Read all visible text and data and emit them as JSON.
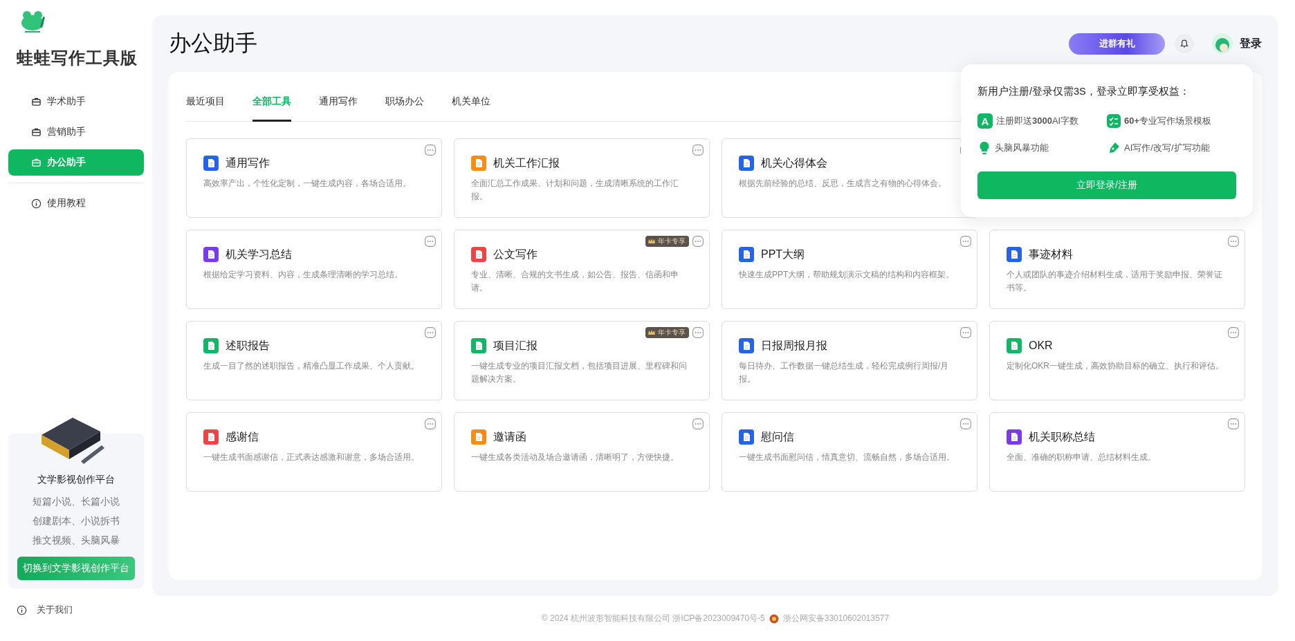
{
  "brand": {
    "title": "蛙蛙写作工具版"
  },
  "nav": [
    {
      "label": "学术助手",
      "selected": false
    },
    {
      "label": "营销助手",
      "selected": false
    },
    {
      "label": "办公助手",
      "selected": true
    }
  ],
  "nav_extra": [
    {
      "label": "使用教程"
    }
  ],
  "promo": {
    "title": "文学影视创作平台",
    "lines": [
      "短篇小说、长篇小说",
      "创建剧本、小说拆书",
      "推文视频、头脑风暴"
    ],
    "button": "切换到文学影视创作平台"
  },
  "about": "关于我们",
  "page_title": "办公助手",
  "header": {
    "group_badge": "进群有礼",
    "login": "登录"
  },
  "tabs": [
    {
      "label": "最近项目",
      "selected": false
    },
    {
      "label": "全部工具",
      "selected": true
    },
    {
      "label": "通用写作",
      "selected": false
    },
    {
      "label": "职场办公",
      "selected": false
    },
    {
      "label": "机关单位",
      "selected": false
    }
  ],
  "card_rows": [
    [
      {
        "title": "通用写作",
        "desc": "高效率产出，个性化定制，一键生成内容，各场合适用。",
        "color": "#2563eb"
      },
      {
        "title": "机关工作汇报",
        "desc": "全面汇总工作成果、计划和问题，生成清晰系统的工作汇报。",
        "color": "#fb8c12"
      },
      {
        "title": "机关心得体会",
        "desc": "根据先前经验的总结、反思，生成言之有物的心得体会。",
        "color": "#2563eb"
      }
    ],
    [
      {
        "title": "机关学习总结",
        "desc": "根据给定学习资料、内容，生成条理清晰的学习总结。",
        "color": "#7c3aed"
      },
      {
        "title": "公文写作",
        "desc": "专业、清晰、合规的文书生成，如公告、报告、信函和申请。",
        "color": "#ef4444",
        "badge": "年卡专享"
      },
      {
        "title": "PPT大纲",
        "desc": "快速生成PPT大纲，帮助规划演示文稿的结构和内容框架。",
        "color": "#2563eb"
      },
      {
        "title": "事迹材料",
        "desc": "个人或团队的事迹介绍材料生成，适用于奖励申报、荣誉证书等。",
        "color": "#2563eb"
      }
    ],
    [
      {
        "title": "述职报告",
        "desc": "生成一目了然的述职报告，精准凸显工作成果、个人贡献。",
        "color": "#10b765"
      },
      {
        "title": "项目汇报",
        "desc": "一键生成专业的项目汇报文档，包括项目进展、里程碑和问题解决方案。",
        "color": "#10b765",
        "badge": "年卡专享"
      },
      {
        "title": "日报周报月报",
        "desc": "每日待办、工作数据一键总结生成，轻松完成例行周报/月报。",
        "color": "#2563eb"
      },
      {
        "title": "OKR",
        "desc": "定制化OKR一键生成，高效协助目标的确立、执行和评估。",
        "color": "#10b765"
      }
    ],
    [
      {
        "title": "感谢信",
        "desc": "一键生成书面感谢信，正式表达感激和谢意，多场合适用。",
        "color": "#ef4444"
      },
      {
        "title": "邀请函",
        "desc": "一键生成各类活动及场合邀请函，清晰明了，方便快捷。",
        "color": "#fb8c12"
      },
      {
        "title": "慰问信",
        "desc": "一键生成书面慰问信，情真意切、流畅自然，多场合适用。",
        "color": "#2563eb"
      },
      {
        "title": "机关职称总结",
        "desc": "全面、准确的职称申请、总结材料生成。",
        "color": "#7c3aed"
      }
    ]
  ],
  "popup": {
    "headline": "新用户注册/登录仅需3S，登录立即享受权益：",
    "perks": [
      {
        "kind": "letter",
        "letter": "A",
        "text": "注册即送**3000**AI字数"
      },
      {
        "kind": "list",
        "text": "**60+**专业写作场景模板"
      },
      {
        "kind": "bulb",
        "text": "头脑风暴功能"
      },
      {
        "kind": "pen",
        "text": "AI写作/改写/扩写功能"
      }
    ],
    "button": "立即登录/注册"
  },
  "footer": {
    "copyright": "© 2024 杭州波形智能科技有限公司 浙ICP备2023009470号-5",
    "police": "浙公网安备33010602013577"
  }
}
